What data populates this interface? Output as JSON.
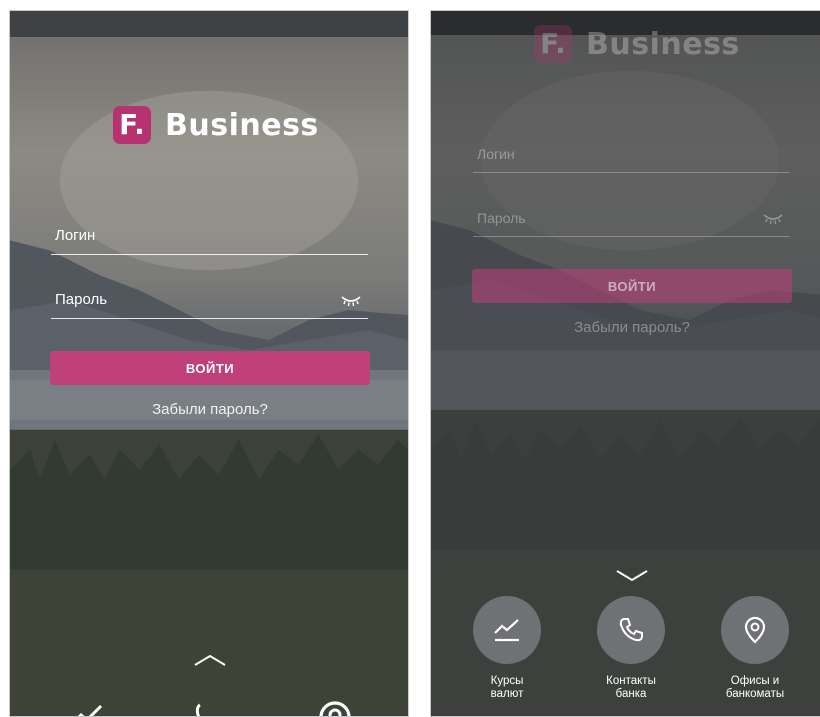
{
  "login_screen": {
    "brand": {
      "mark": "F.",
      "name": "Business"
    },
    "login_field": {
      "placeholder": "Логин"
    },
    "password_field": {
      "placeholder": "Пароль"
    },
    "submit_label": "ВОЙТИ",
    "forgot_link": "Забыли пароль?",
    "expand_icon": "chevron-up-icon",
    "dock_icons": [
      "chart-icon",
      "phone-icon",
      "location-pin-icon"
    ]
  },
  "quick_panel": {
    "collapse_icon": "chevron-down-icon",
    "actions": [
      {
        "icon": "chart-icon",
        "line1": "Курсы",
        "line2": "валют"
      },
      {
        "icon": "phone-icon",
        "line1": "Контакты",
        "line2": "банка"
      },
      {
        "icon": "location-pin-icon",
        "line1": "Офисы и",
        "line2": "банкоматы"
      }
    ]
  },
  "colors": {
    "accent": "#c0407a",
    "brand_mark": "#b6336f"
  }
}
